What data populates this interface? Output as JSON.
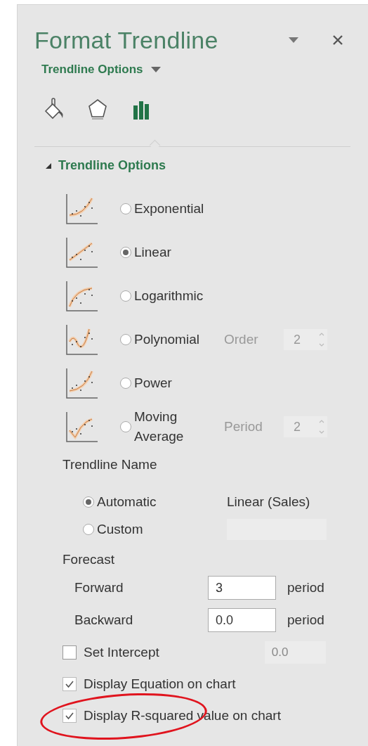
{
  "panel": {
    "title": "Format Trendline",
    "subtitle": "Trendline Options"
  },
  "tabs": [
    {
      "kind": "fill",
      "selected": false
    },
    {
      "kind": "effects",
      "selected": false
    },
    {
      "kind": "options",
      "selected": true
    }
  ],
  "section": {
    "title": "Trendline Options",
    "expanded": true
  },
  "trend_types": [
    {
      "kind": "exponential",
      "label": "Exponential",
      "selected": false
    },
    {
      "kind": "linear",
      "label": "Linear",
      "selected": true
    },
    {
      "kind": "logarithmic",
      "label": "Logarithmic",
      "selected": false
    },
    {
      "kind": "polynomial",
      "label": "Polynomial",
      "selected": false,
      "param_label": "Order",
      "param_value": "2",
      "disabled": true
    },
    {
      "kind": "power",
      "label": "Power",
      "selected": false
    },
    {
      "kind": "moving_average",
      "label": "Moving Average",
      "selected": false,
      "param_label": "Period",
      "param_value": "2",
      "disabled": true
    }
  ],
  "trendline_name": {
    "title": "Trendline Name",
    "options": [
      {
        "kind": "text",
        "label": "Automatic",
        "selected": true,
        "value": "Linear (Sales)"
      },
      {
        "kind": "field",
        "label": "Custom",
        "selected": false
      }
    ]
  },
  "forecast": {
    "title": "Forecast",
    "rows": [
      {
        "label": "Forward",
        "value": "3",
        "unit": "period"
      },
      {
        "label": "Backward",
        "value": "0.0",
        "unit": "period"
      }
    ]
  },
  "intercept": {
    "label": "Set Intercept",
    "checked": false,
    "value": "0.0",
    "disabled": true
  },
  "checks": [
    {
      "label": "Display Equation on chart",
      "checked": true
    },
    {
      "label": "Display R-squared value on chart",
      "checked": true
    }
  ],
  "highlight": {
    "kind": "ellipse"
  }
}
